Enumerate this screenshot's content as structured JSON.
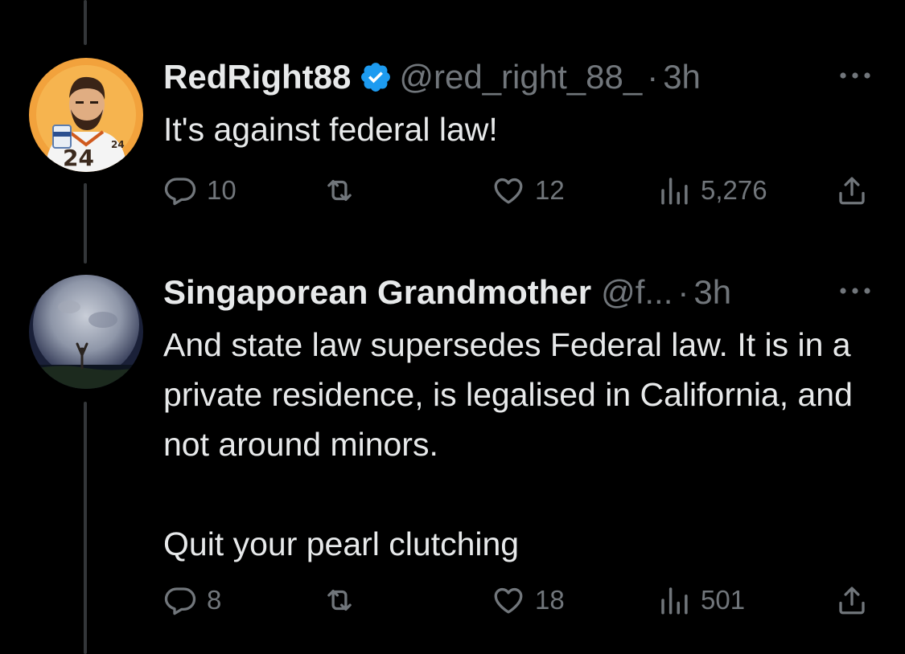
{
  "tweets": [
    {
      "display_name": "RedRight88",
      "verified": true,
      "handle": "@red_right_88_",
      "dot": "·",
      "time": "3h",
      "text_lines": [
        "It's against federal law!"
      ],
      "reply_count": "10",
      "retweet_count": "",
      "like_count": "12",
      "view_count": "5,276"
    },
    {
      "display_name": "Singaporean Grandmother",
      "verified": false,
      "handle": "@f...",
      "dot": "·",
      "time": "3h",
      "text_lines": [
        "And state law supersedes Federal law. It is in a private residence, is legalised in California, and not around minors.",
        "Quit your pearl clutching"
      ],
      "reply_count": "8",
      "retweet_count": "",
      "like_count": "18",
      "view_count": "501"
    }
  ],
  "icons": {
    "reply": "reply-icon",
    "retweet": "retweet-icon",
    "like": "heart-icon",
    "views": "views-icon",
    "share": "share-icon",
    "more": "more-icon",
    "verified": "verified-badge-icon"
  },
  "colors": {
    "background": "#000000",
    "text": "#e7e9ea",
    "secondary": "#71767b",
    "verified": "#1d9bf0",
    "thread_line": "#333639"
  }
}
